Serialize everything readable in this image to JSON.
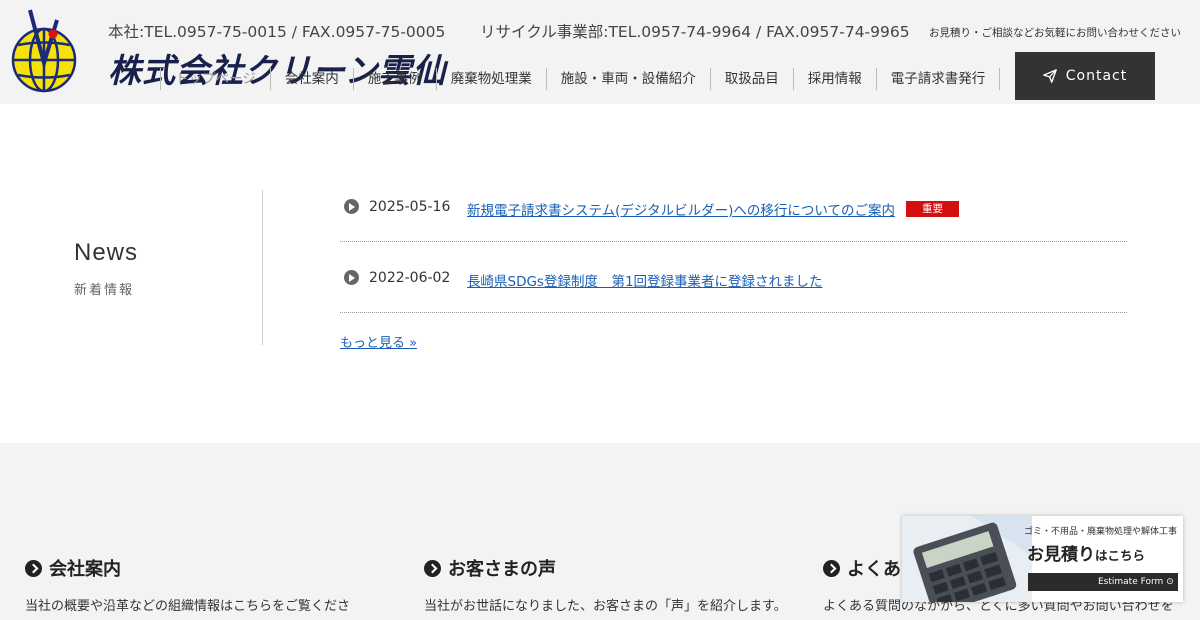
{
  "header": {
    "company_name": "株式会社クリーン雲仙",
    "contact_main": "本社:TEL.0957-75-0015 /  FAX.0957-75-0005",
    "contact_recycle": "リサイクル事業部:TEL.0957-74-9964  /  FAX.0957-74-9965",
    "inquiry_note": "お見積り・ご相談などお気軽にお問い合わせください",
    "contact_button": "Contact"
  },
  "nav": {
    "items": [
      "トップページ",
      "会社案内",
      "施工事例",
      "廃棄物処理業",
      "施設・車両・設備紹介",
      "取扱品目",
      "採用情報",
      "電子請求書発行"
    ]
  },
  "news": {
    "heading": "News",
    "subheading": "新着情報",
    "items": [
      {
        "date": "2025-05-16",
        "title": "新規電子請求書システム(デジタルビルダー)への移行についてのご案内",
        "badge": "重要"
      },
      {
        "date": "2022-06-02",
        "title": "長崎県SDGs登録制度　第1回登録事業者に登録されました"
      }
    ],
    "more": "もっと見る »"
  },
  "cards": [
    {
      "title": "会社案内",
      "text": "当社の概要や沿革などの組織情報はこちらをご覧くださ"
    },
    {
      "title": "お客さまの声",
      "text": "当社がお世話になりました、お客さまの「声」を紹介します。"
    },
    {
      "title": "よくある",
      "text": "よくある質問のなかから、とくに多い質問やお問い合わせを"
    }
  ],
  "estimate_banner": {
    "small": "ゴミ・不用品・廃棄物処理や解体工事",
    "main": "お見積り",
    "main_suffix": "はこちら",
    "bar": "Estimate Form ⊙"
  },
  "colors": {
    "header_bg": "#f3f3f3",
    "contact_btn": "#333333",
    "link": "#1a5fb4",
    "badge": "#d30f0f",
    "logo_globe": "#f5e20a",
    "logo_text": "#17214a"
  }
}
